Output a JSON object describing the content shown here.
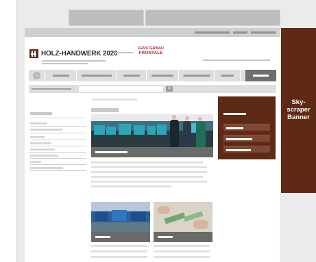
{
  "colors": {
    "brand": "#5e2a16",
    "partner_red": "#b5292c",
    "wireframe_gray": "#dedede",
    "cta_gray": "#6f6f6f"
  },
  "header": {
    "logo_text": "HOLZ-HANDWERK 2020",
    "logo_icon": "hh-logo-icon",
    "partner_logo_top": "FENSTERBAU",
    "partner_logo_bottom": "FRONTALE"
  },
  "nav": {
    "home_icon": "home-icon"
  },
  "search": {
    "go_icon": "search-icon"
  },
  "ads": {
    "skyscraper_label": "Sky-\nscraper\nBanner"
  }
}
